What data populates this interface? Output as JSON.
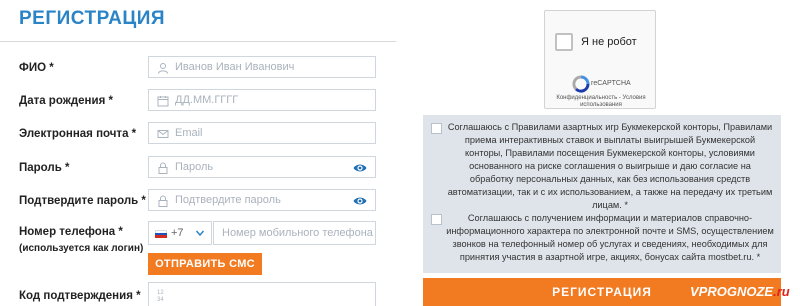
{
  "form": {
    "title": "РЕГИСТРАЦИЯ",
    "fields": [
      {
        "label": "ФИО *",
        "placeholder": "Иванов Иван Иванович",
        "icon": "user-icon"
      },
      {
        "label": "Дата рождения *",
        "placeholder": "ДД.ММ.ГГГГ",
        "icon": "calendar-icon"
      },
      {
        "label": "Электронная почта *",
        "placeholder": "Email",
        "icon": "envelope-icon"
      },
      {
        "label": "Пароль *",
        "placeholder": "Пароль",
        "icon": "lock-icon"
      },
      {
        "label": "Подтвердите пароль *",
        "placeholder": "Подтвердите пароль",
        "icon": "lock-icon"
      }
    ],
    "phone": {
      "label": "Номер телефона *",
      "sublabel": "(используется как логин)",
      "code": "+7",
      "placeholder": "Номер мобильного телефона"
    },
    "sms_button": "ОТПРАВИТЬ СМС",
    "code_label": "Код подтверждения *"
  },
  "captcha": {
    "label": "Я не робот",
    "brand": "reCAPTCHA",
    "terms": "Конфиденциальность - Условия использования"
  },
  "consents": [
    "Соглашаюсь с Правилами азартных игр Букмекерской конторы, Правилами приема интерактивных ставок и выплаты выигрышей Букмекерской конторы, Правилами посещения Букмекерской конторы, условиями основанного на риске соглашения о выигрыше и даю согласие на обработку персональных данных, как без использования средств автоматизации, так и с их использованием, а также на передачу их третьим лицам. *",
    "Соглашаюсь с получением информации и материалов справочно-информационного характера по электронной почте и SMS, осуществлением звонков на телефонный номер об услугах и сведениях, необходимых для принятия участия в азартной игре, акциях, бонусах сайта mostbet.ru. *"
  ],
  "register_button": "РЕГИСТРАЦИЯ",
  "watermark": {
    "main": "VPROGNOZE",
    "suffix": ".ru"
  },
  "colors": {
    "accent": "#2b84c6",
    "button": "#f27a21",
    "consent_bg": "#dfe4ea"
  }
}
